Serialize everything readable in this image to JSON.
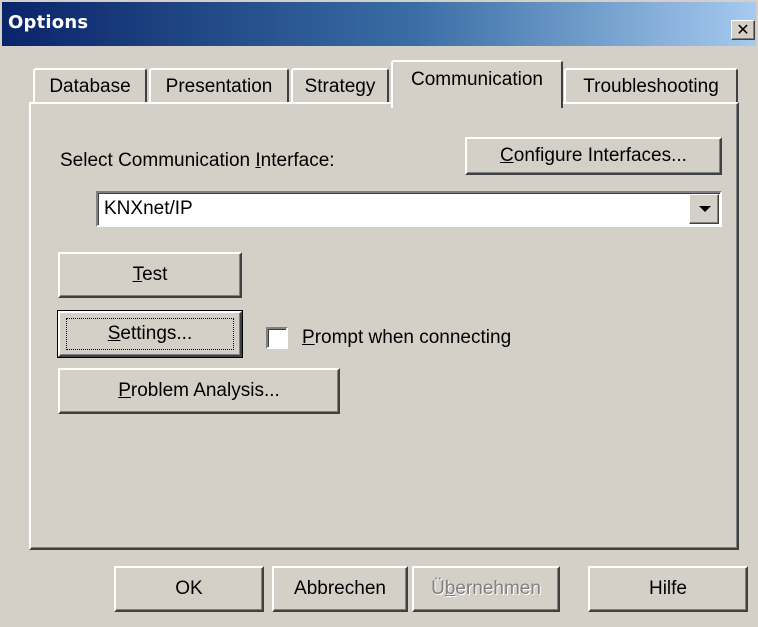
{
  "window": {
    "title": "Options",
    "close_glyph": "✕"
  },
  "tabs": [
    {
      "label": "Database"
    },
    {
      "label": "Presentation"
    },
    {
      "label": "Strategy"
    },
    {
      "label": "Communication",
      "active": true
    },
    {
      "label": "Troubleshooting"
    }
  ],
  "communication": {
    "interface_label_pre": "Select Communication ",
    "interface_label_accel": "I",
    "interface_label_post": "nterface:",
    "configure_accel": "C",
    "configure_rest": "onfigure Interfaces...",
    "interface_value": "KNXnet/IP",
    "test_accel": "T",
    "test_rest": "est",
    "settings_accel": "S",
    "settings_rest": "ettings...",
    "prompt_accel": "P",
    "prompt_rest": "rompt when connecting",
    "prompt_checked": false,
    "problem_accel": "P",
    "problem_rest": "roblem Analysis..."
  },
  "footer": {
    "ok": "OK",
    "cancel": "Abbrechen",
    "apply_pre": "Ü",
    "apply_accel": "b",
    "apply_post": "ernehmen",
    "help": "Hilfe"
  },
  "icons": {
    "close": "close-icon",
    "dropdown": "chevron-down-icon"
  }
}
